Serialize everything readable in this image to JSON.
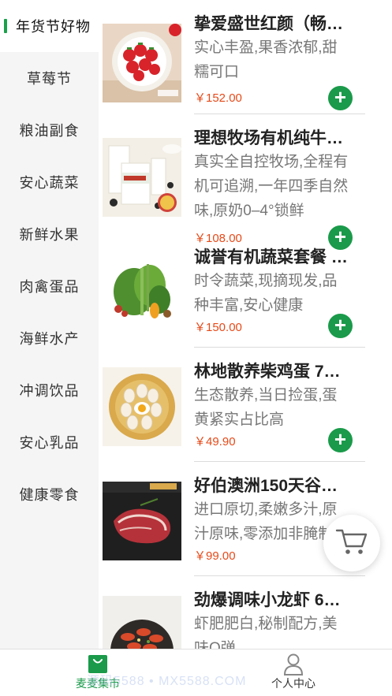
{
  "sidebar": {
    "items": [
      {
        "label": "年货节好物"
      },
      {
        "label": "草莓节"
      },
      {
        "label": "粮油副食"
      },
      {
        "label": "安心蔬菜"
      },
      {
        "label": "新鲜水果"
      },
      {
        "label": "肉禽蛋品"
      },
      {
        "label": "海鲜水产"
      },
      {
        "label": "冲调饮品"
      },
      {
        "label": "安心乳品"
      },
      {
        "label": "健康零食"
      }
    ],
    "active_index": 0,
    "accent_color": "#1aa14a"
  },
  "products": [
    {
      "title": "挚爱盛世红颜（畅…",
      "desc": "实心丰盈,果香浓郁,甜糯可口",
      "price": "￥152.00",
      "image": "strawberries"
    },
    {
      "title": "理想牧场有机纯牛…",
      "desc": "真实全自控牧场,全程有机可追溯,一年四季自然味,原奶0–4°锁鲜",
      "price": "￥108.00",
      "image": "milk"
    },
    {
      "title": "诚誉有机蔬菜套餐 …",
      "desc": "时令蔬菜,现摘现发,品种丰富,安心健康",
      "price": "￥150.00",
      "image": "vegetables"
    },
    {
      "title": "林地散养柴鸡蛋 7…",
      "desc": "生态散养,当日捡蛋,蛋黄紧实占比高",
      "price": "￥49.90",
      "image": "eggs"
    },
    {
      "title": "好伯澳洲150天谷…",
      "desc": "进口原切,柔嫩多汁,原汁原味,零添加非腌制",
      "price": "￥99.00",
      "image": "steak"
    },
    {
      "title": "劲爆调味小龙虾 6…",
      "desc": "虾肥肥白,秘制配方,美味Q弹",
      "price": "",
      "image": "crayfish"
    }
  ],
  "add_button": {
    "label": "+",
    "color": "#1a9a4a"
  },
  "price_color": "#e64a19",
  "cart": {
    "icon": "cart-icon"
  },
  "tabbar": {
    "home": {
      "label": "麦麦集市",
      "icon": "shop-bag-icon",
      "active": true
    },
    "me": {
      "label": "个人中心",
      "icon": "person-icon",
      "active": false
    }
  },
  "watermark": "源码5588 • MX5588.COM"
}
